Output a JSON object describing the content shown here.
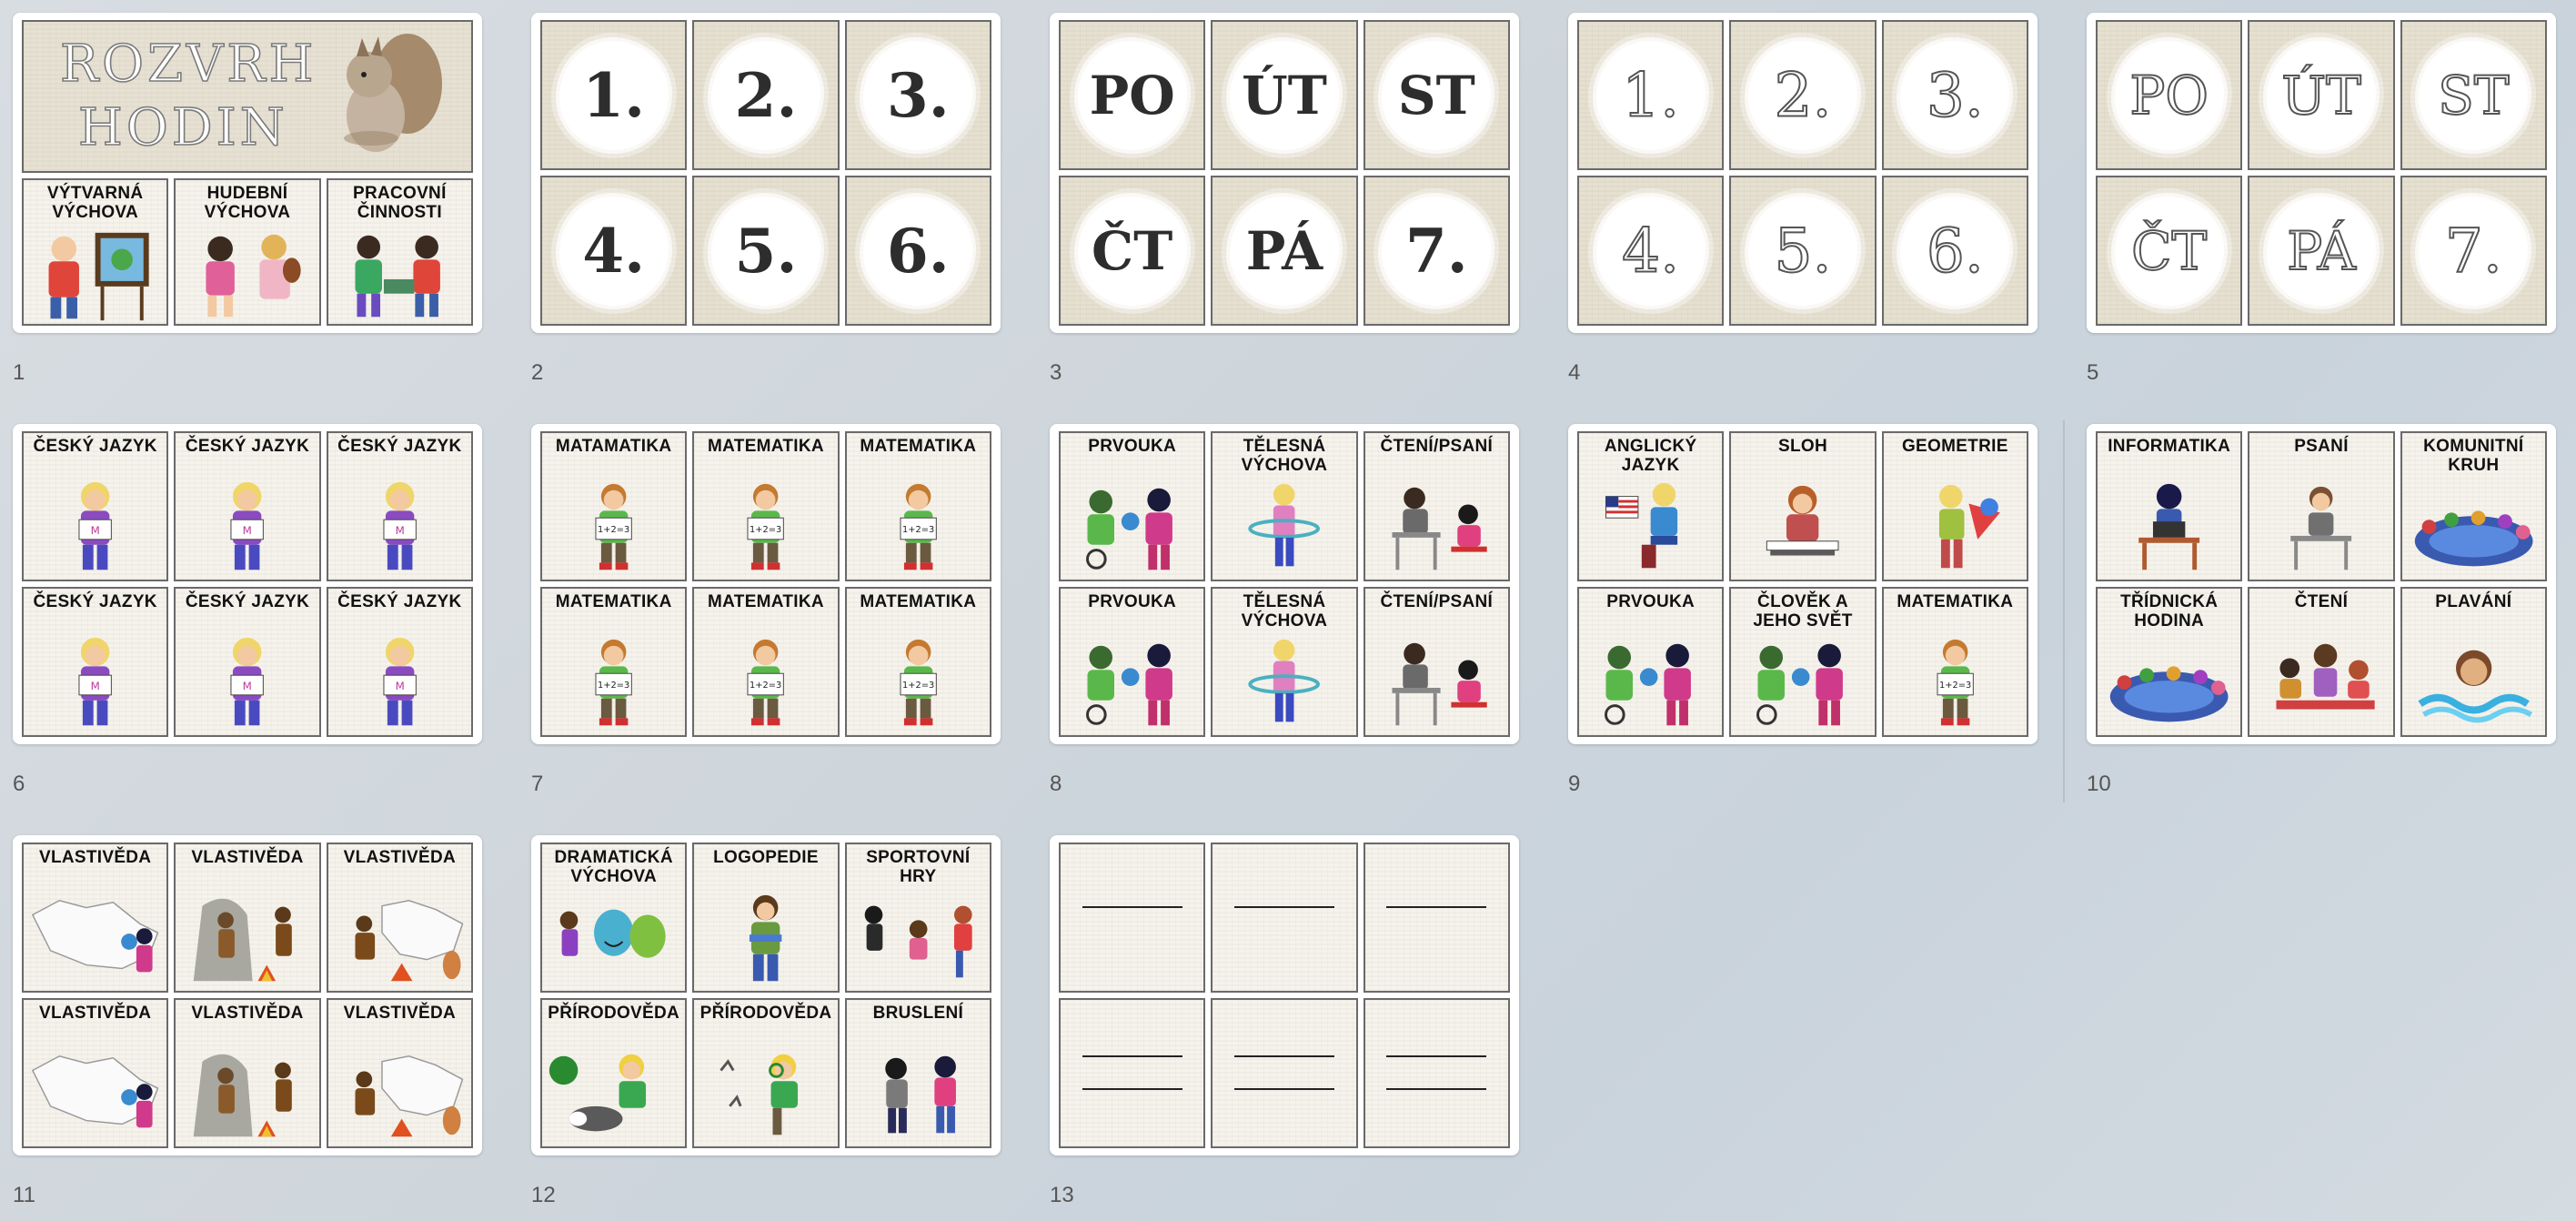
{
  "slides": [
    {
      "number": "1",
      "title_line1": "ROZVRH",
      "title_line2": "HODIN",
      "cards": [
        "VÝTVARNÁ VÝCHOVA",
        "HUDEBNÍ VÝCHOVA",
        "PRACOVNÍ ČINNOSTI"
      ]
    },
    {
      "number": "2",
      "badges": [
        "1.",
        "2.",
        "3.",
        "4.",
        "5.",
        "6."
      ]
    },
    {
      "number": "3",
      "badges": [
        "PO",
        "ÚT",
        "ST",
        "ČT",
        "PÁ",
        "7."
      ]
    },
    {
      "number": "4",
      "badges": [
        "1.",
        "2.",
        "3.",
        "4.",
        "5.",
        "6."
      ]
    },
    {
      "number": "5",
      "badges": [
        "PO",
        "ÚT",
        "ST",
        "ČT",
        "PÁ",
        "7."
      ]
    },
    {
      "number": "6",
      "cards": [
        "ČESKÝ JAZYK",
        "ČESKÝ JAZYK",
        "ČESKÝ JAZYK",
        "ČESKÝ JAZYK",
        "ČESKÝ JAZYK",
        "ČESKÝ JAZYK"
      ]
    },
    {
      "number": "7",
      "cards": [
        "MATAMATIKA",
        "MATEMATIKA",
        "MATEMATIKA",
        "MATEMATIKA",
        "MATEMATIKA",
        "MATEMATIKA"
      ]
    },
    {
      "number": "8",
      "cards": [
        "PRVOUKA",
        "TĚLESNÁ VÝCHOVA",
        "ČTENÍ/PSANÍ",
        "PRVOUKA",
        "TĚLESNÁ VÝCHOVA",
        "ČTENÍ/PSANÍ"
      ]
    },
    {
      "number": "9",
      "cards": [
        "ANGLICKÝ JAZYK",
        "SLOH",
        "GEOMETRIE",
        "PRVOUKA",
        "ČLOVĚK A JEHO SVĚT",
        "MATEMATIKA"
      ]
    },
    {
      "number": "10",
      "cards": [
        "INFORMATIKA",
        "PSANÍ",
        "KOMUNITNÍ KRUH",
        "TŘÍDNICKÁ HODINA",
        "ČTENÍ",
        "PLAVÁNÍ"
      ]
    },
    {
      "number": "11",
      "cards": [
        "VLASTIVĚDA",
        "VLASTIVĚDA",
        "VLASTIVĚDA",
        "VLASTIVĚDA",
        "VLASTIVĚDA",
        "VLASTIVĚDA"
      ]
    },
    {
      "number": "12",
      "cards": [
        "DRAMATICKÁ VÝCHOVA",
        "LOGOPEDIE",
        "SPORTOVNÍ HRY",
        "PŘÍRODOVĚDA",
        "PŘÍRODOVĚDA",
        "BRUSLENÍ"
      ]
    },
    {
      "number": "13"
    }
  ],
  "icons": {
    "math_board": "1+2=3"
  }
}
